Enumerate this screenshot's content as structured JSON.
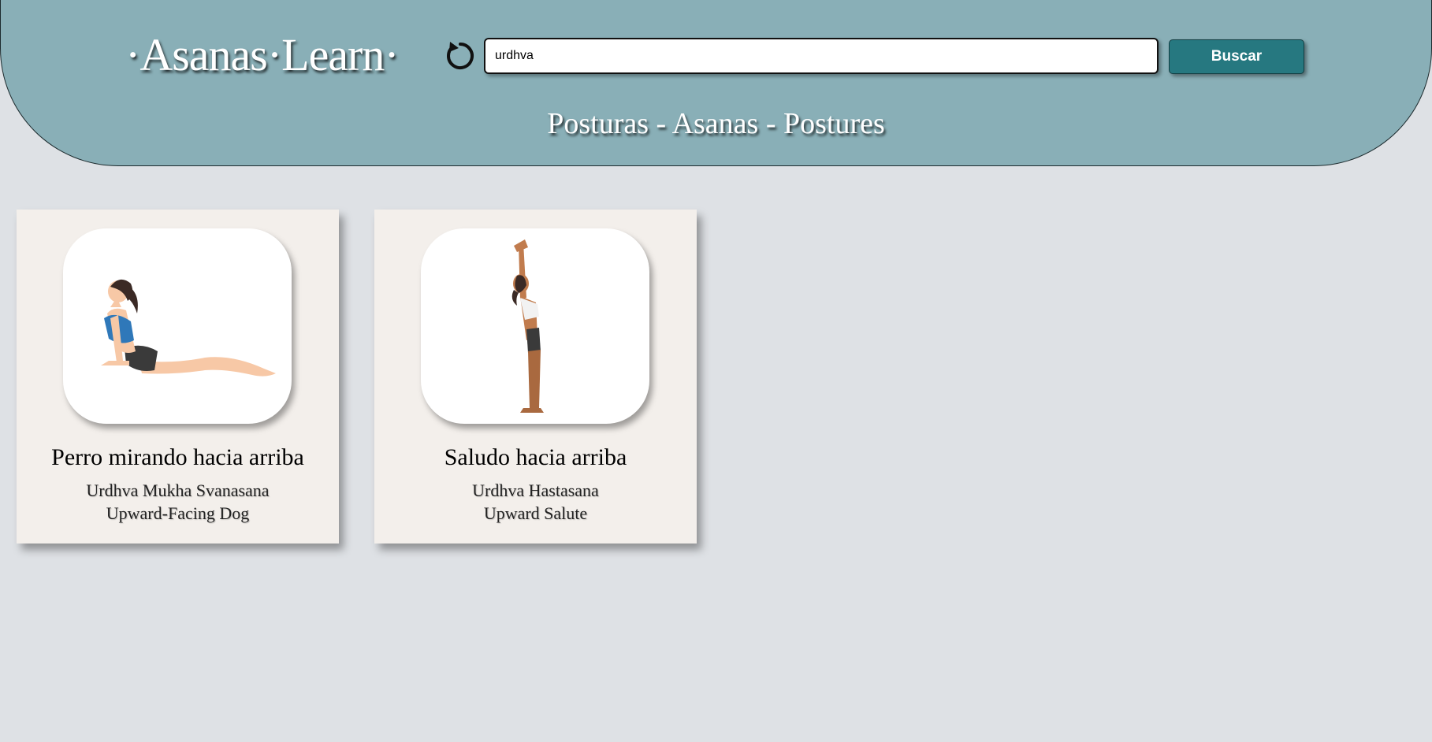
{
  "header": {
    "logo": "·Asanas·Learn·",
    "subtitle": "Posturas - Asanas - Postures",
    "reset_icon": "refresh-icon"
  },
  "search": {
    "value": "urdhva",
    "button_label": "Buscar"
  },
  "colors": {
    "header_bg": "#89afb7",
    "page_bg": "#dee1e5",
    "button_bg": "#267880",
    "card_bg": "#f3efeb"
  },
  "cards": [
    {
      "title": "Perro mirando hacia arriba",
      "sanskrit": "Urdhva Mukha Svanasana",
      "english": "Upward-Facing Dog",
      "image": "upward-facing-dog-illustration"
    },
    {
      "title": "Saludo hacia arriba",
      "sanskrit": "Urdhva Hastasana",
      "english": "Upward Salute",
      "image": "upward-salute-illustration"
    }
  ]
}
